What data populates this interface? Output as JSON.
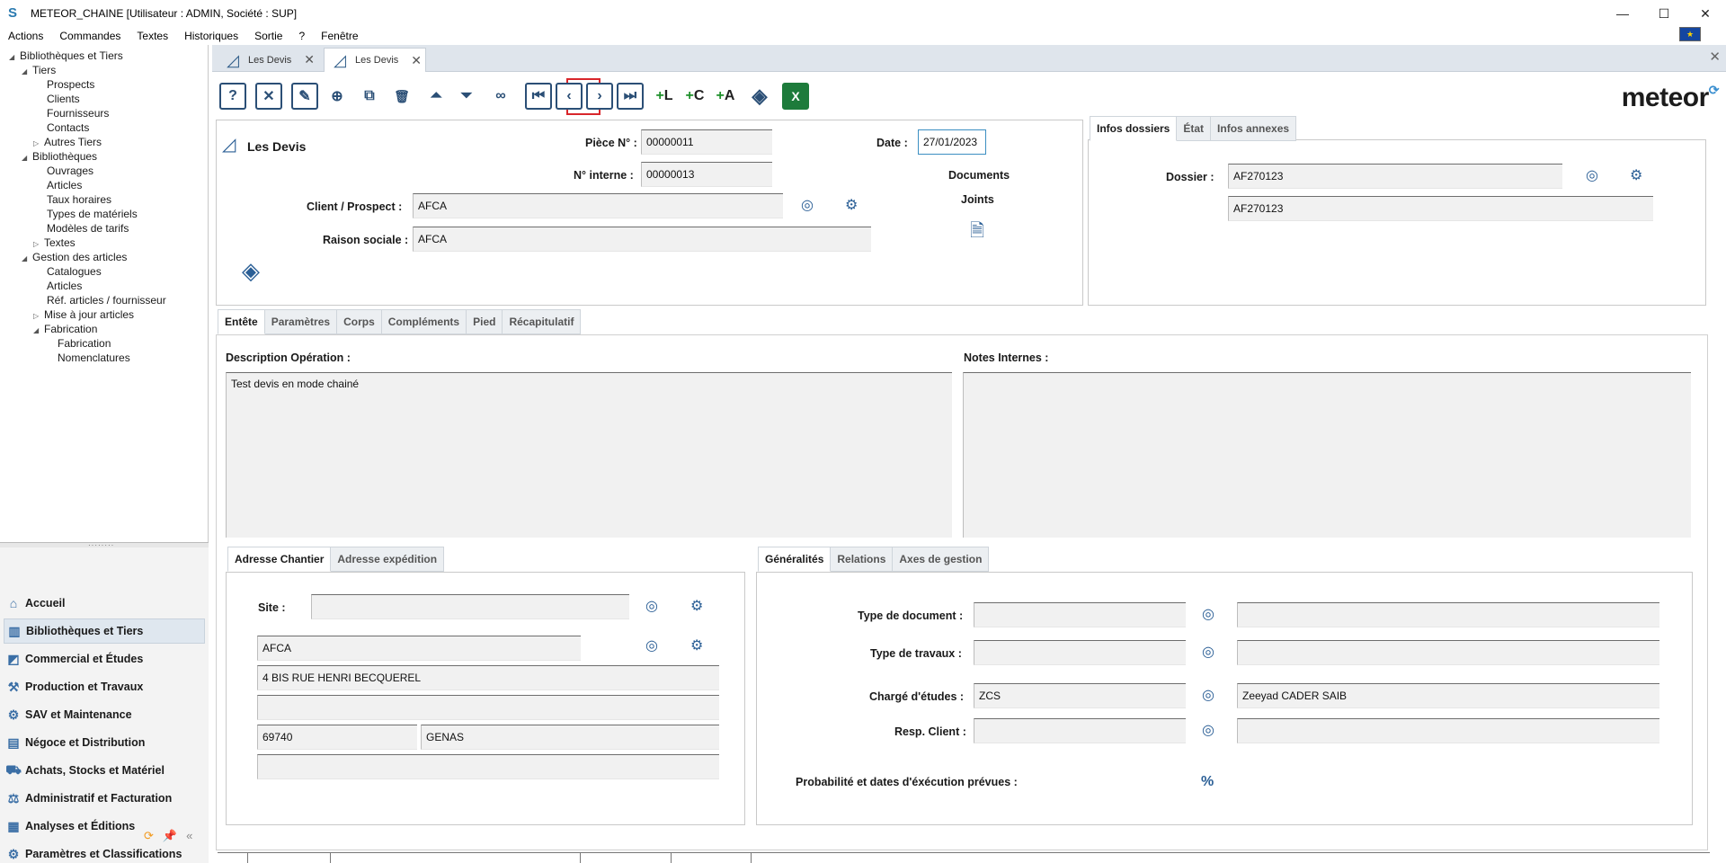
{
  "window": {
    "title": "METEOR_CHAINE [Utilisateur : ADMIN, Société : SUP]",
    "minimize": "—",
    "maximize": "☐",
    "close": "✕"
  },
  "menu": [
    "Actions",
    "Commandes",
    "Textes",
    "Historiques",
    "Sortie",
    "?",
    "Fenêtre"
  ],
  "tree": [
    {
      "label": "Bibliothèques et Tiers",
      "arrow": "◢",
      "level": 0
    },
    {
      "label": "Tiers",
      "arrow": "◢",
      "level": 1
    },
    {
      "label": "Prospects",
      "arrow": "",
      "level": 2
    },
    {
      "label": "Clients",
      "arrow": "",
      "level": 2
    },
    {
      "label": "Fournisseurs",
      "arrow": "",
      "level": 2
    },
    {
      "label": "Contacts",
      "arrow": "",
      "level": 2
    },
    {
      "label": "Autres Tiers",
      "arrow": "▷",
      "level": 1.5
    },
    {
      "label": "Bibliothèques",
      "arrow": "◢",
      "level": 1
    },
    {
      "label": "Ouvrages",
      "arrow": "",
      "level": 2
    },
    {
      "label": "Articles",
      "arrow": "",
      "level": 2
    },
    {
      "label": "Taux horaires",
      "arrow": "",
      "level": 2
    },
    {
      "label": "Types de matériels",
      "arrow": "",
      "level": 2
    },
    {
      "label": "Modèles de tarifs",
      "arrow": "",
      "level": 2
    },
    {
      "label": "Textes",
      "arrow": "▷",
      "level": 1.5
    },
    {
      "label": "Gestion des articles",
      "arrow": "◢",
      "level": 1
    },
    {
      "label": "Catalogues",
      "arrow": "",
      "level": 2
    },
    {
      "label": "Articles",
      "arrow": "",
      "level": 2
    },
    {
      "label": "Réf. articles / fournisseur",
      "arrow": "",
      "level": 2
    },
    {
      "label": "Mise à jour articles",
      "arrow": "▷",
      "level": 1.5
    },
    {
      "label": "Fabrication",
      "arrow": "◢",
      "level": 1.5
    },
    {
      "label": "Fabrication",
      "arrow": "",
      "level": 3
    },
    {
      "label": "Nomenclatures",
      "arrow": "",
      "level": 3
    }
  ],
  "nav": [
    {
      "label": "Accueil",
      "icon": "home-icon",
      "glyph": "⌂"
    },
    {
      "label": "Bibliothèques et Tiers",
      "icon": "library-icon",
      "glyph": "▥"
    },
    {
      "label": "Commercial et Études",
      "icon": "commercial-icon",
      "glyph": "◩"
    },
    {
      "label": "Production et Travaux",
      "icon": "production-icon",
      "glyph": "⚒"
    },
    {
      "label": "SAV et Maintenance",
      "icon": "maintenance-icon",
      "glyph": "⚙"
    },
    {
      "label": "Négoce et Distribution",
      "icon": "distribution-icon",
      "glyph": "▤"
    },
    {
      "label": "Achats, Stocks et Matériel",
      "icon": "cart-icon",
      "glyph": "⛟"
    },
    {
      "label": "Administratif et Facturation",
      "icon": "admin-icon",
      "glyph": "⚖"
    },
    {
      "label": "Analyses et Éditions",
      "icon": "analysis-icon",
      "glyph": "▦"
    },
    {
      "label": "Paramètres et Classifications",
      "icon": "settings-icon",
      "glyph": "⚙"
    }
  ],
  "tabs": [
    {
      "label": "Les Devis",
      "active": false
    },
    {
      "label": "Les Devis",
      "active": true
    }
  ],
  "toolbar": {
    "help": "?",
    "cancel": "✕",
    "edit": "✎",
    "add": "⊕",
    "duplicate": "⧉",
    "delete": "🗑",
    "up": "⏶",
    "down": "⏷",
    "search": "∞",
    "first": "⏮",
    "prev": "‹",
    "next": "›",
    "last": "⏭",
    "add_l": "L",
    "add_c": "C",
    "add_a": "A",
    "layers": "◈",
    "excel": "X",
    "logo": "meteor"
  },
  "header": {
    "title": "Les Devis",
    "piece_label": "Pièce N° :",
    "piece_value": "00000011",
    "interne_label": "N° interne :",
    "interne_value": "00000013",
    "date_label": "Date :",
    "date_value": "27/01/2023",
    "documents_label": "Documents",
    "joints_label": "Joints",
    "client_label": "Client / Prospect :",
    "client_value": "AFCA",
    "raison_label": "Raison sociale :",
    "raison_value": "AFCA"
  },
  "dossier": {
    "tabs": [
      "Infos dossiers",
      "État",
      "Infos annexes"
    ],
    "label": "Dossier :",
    "value": "AF270123",
    "value2": "AF270123"
  },
  "main_tabs": [
    "Entête",
    "Paramètres",
    "Corps",
    "Compléments",
    "Pied",
    "Récapitulatif"
  ],
  "description": {
    "label": "Description Opération :",
    "value": "Test devis en mode chainé"
  },
  "notes": {
    "label": "Notes Internes :",
    "value": ""
  },
  "address": {
    "tabs": [
      "Adresse Chantier",
      "Adresse expédition"
    ],
    "site_label": "Site :",
    "site_value": "",
    "name": "AFCA",
    "line1": "4 BIS RUE HENRI BECQUEREL",
    "line2": "",
    "zip": "69740",
    "city": "GENAS",
    "line3": ""
  },
  "general": {
    "tabs": [
      "Généralités",
      "Relations",
      "Axes de gestion"
    ],
    "type_doc_label": "Type de document :",
    "type_doc_code": "",
    "type_doc_desc": "",
    "type_trav_label": "Type de travaux :",
    "type_trav_code": "",
    "type_trav_desc": "",
    "charge_label": "Chargé d'études :",
    "charge_code": "ZCS",
    "charge_name": "Zeeyad CADER SAIB",
    "resp_label": "Resp. Client :",
    "resp_code": "",
    "resp_name": "",
    "proba_label": "Probabilité et dates d'éxécution prévues :",
    "proba_icon": "%"
  }
}
